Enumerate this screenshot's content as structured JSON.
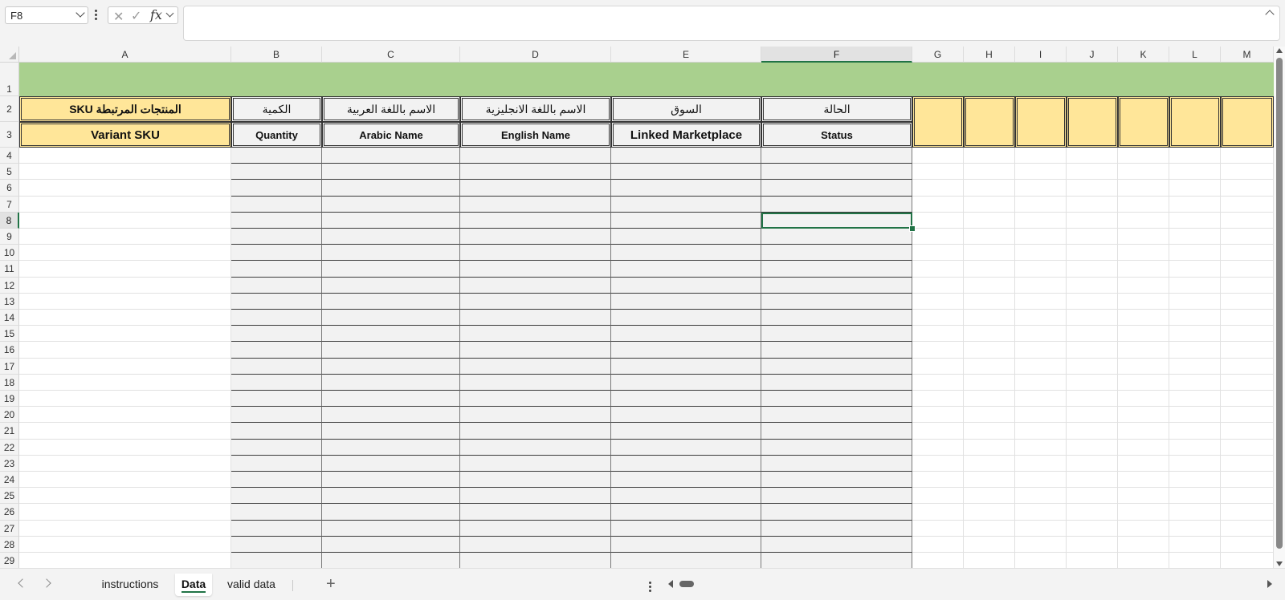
{
  "formula_bar": {
    "name_box": "F8",
    "formula_value": "",
    "cancel_icon": "x-icon",
    "enter_icon": "check-icon",
    "function_label": "fx"
  },
  "columns": [
    "A",
    "B",
    "C",
    "D",
    "E",
    "F",
    "G",
    "H",
    "I",
    "J",
    "K",
    "L",
    "M"
  ],
  "selected_cell": "F8",
  "rows": [
    "1",
    "2",
    "3",
    "4",
    "5",
    "6",
    "7",
    "8",
    "9",
    "10",
    "11",
    "12",
    "13",
    "14",
    "15",
    "16",
    "17",
    "18",
    "19",
    "20",
    "21",
    "22",
    "23",
    "24",
    "25",
    "26",
    "27",
    "28",
    "29"
  ],
  "headers": {
    "arabic": {
      "A": "المنتجات المرتبطة SKU",
      "B": "الكمية",
      "C": "الاسم باللغة العربية",
      "D": "الاسم باللغة الانجليزية",
      "E": "السوق",
      "F": "الحالة"
    },
    "english": {
      "A": "Variant SKU",
      "B": "Quantity",
      "C": "Arabic Name",
      "D": "English Name",
      "E": "Linked Marketplace",
      "F": "Status"
    }
  },
  "colors": {
    "band_green": "#a9d08e",
    "header_yellow": "#ffe699",
    "data_gray": "#f2f2f2",
    "accent": "#217346"
  },
  "sheet_tabs": [
    {
      "label": "instructions",
      "active": false
    },
    {
      "label": "Data",
      "active": true
    },
    {
      "label": "valid data",
      "active": false
    }
  ]
}
